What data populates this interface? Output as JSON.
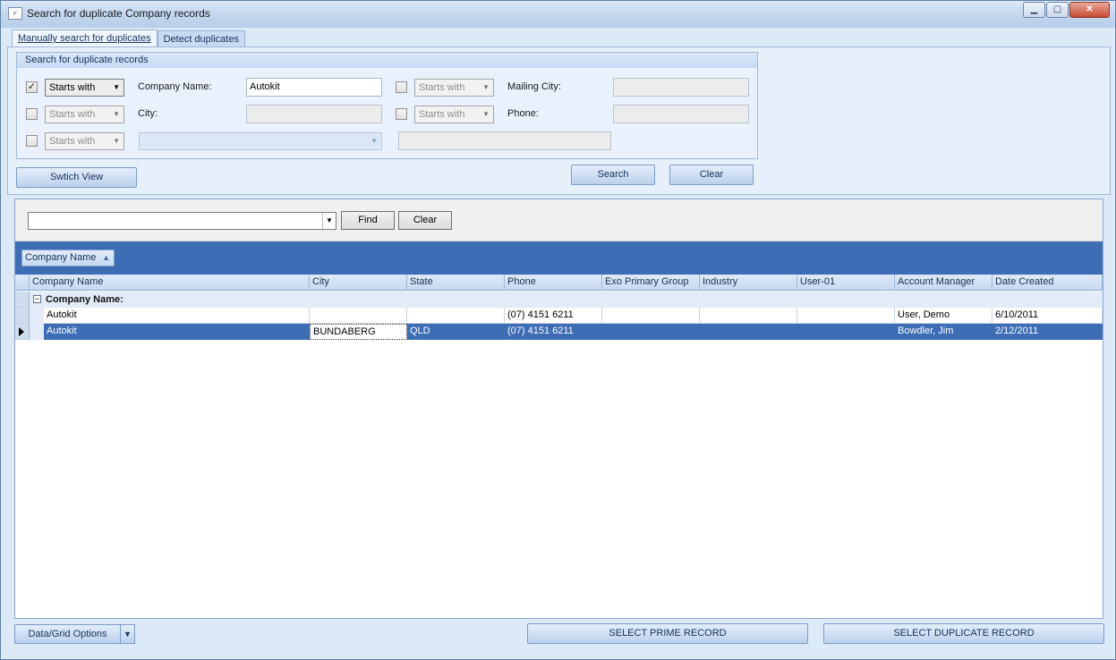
{
  "window": {
    "title": "Search for duplicate Company records",
    "icon": "app-icon",
    "controls": {
      "minimize": "0",
      "maximize": "1",
      "close": "r"
    }
  },
  "tabs": [
    {
      "label": "Manually search for duplicates",
      "active": true
    },
    {
      "label": "Detect duplicates",
      "active": false
    }
  ],
  "search_group": {
    "title": "Search for duplicate records",
    "rows": [
      {
        "checked": true,
        "match": "Starts with",
        "label": "Company Name:",
        "value": "Autokit",
        "right_checked": false,
        "right_match": "Starts with",
        "right_label": "Mailing City:",
        "right_value": ""
      },
      {
        "checked": false,
        "match": "Starts with",
        "label": "City:",
        "value": "",
        "right_checked": false,
        "right_match": "Starts with",
        "right_label": "Phone:",
        "right_value": ""
      },
      {
        "checked": false,
        "match": "Starts with",
        "field_select": "",
        "value": ""
      }
    ],
    "check_mark": "✓"
  },
  "buttons": {
    "switch_view": "Swtich View",
    "search": "Search",
    "clear": "Clear",
    "find": "Find",
    "find_clear": "Clear",
    "data_grid_options": "Data/Grid Options",
    "select_prime": "SELECT PRIME RECORD",
    "select_duplicate": "SELECT DUPLICATE RECORD"
  },
  "find_bar": {
    "value": ""
  },
  "grid": {
    "group_by_chip": "Company Name",
    "columns": [
      "Company Name",
      "City",
      "State",
      "Phone",
      "Exo Primary Group",
      "Industry",
      "User-01",
      "Account Manager",
      "Date Created"
    ],
    "group_label": "Company Name:",
    "rows": [
      [
        "Autokit",
        "",
        "",
        "(07) 4151 6211",
        "",
        "",
        "",
        "User, Demo",
        "6/10/2011"
      ],
      [
        "Autokit",
        "BUNDABERG",
        "QLD",
        "(07) 4151 6211",
        "",
        "",
        "",
        "Bowdler, Jim",
        "2/12/2011"
      ]
    ],
    "selected_row": 1
  },
  "colors": {
    "accent": "#3d6db5",
    "window_bg": "#dce9f7",
    "header_text": "#15325c"
  }
}
